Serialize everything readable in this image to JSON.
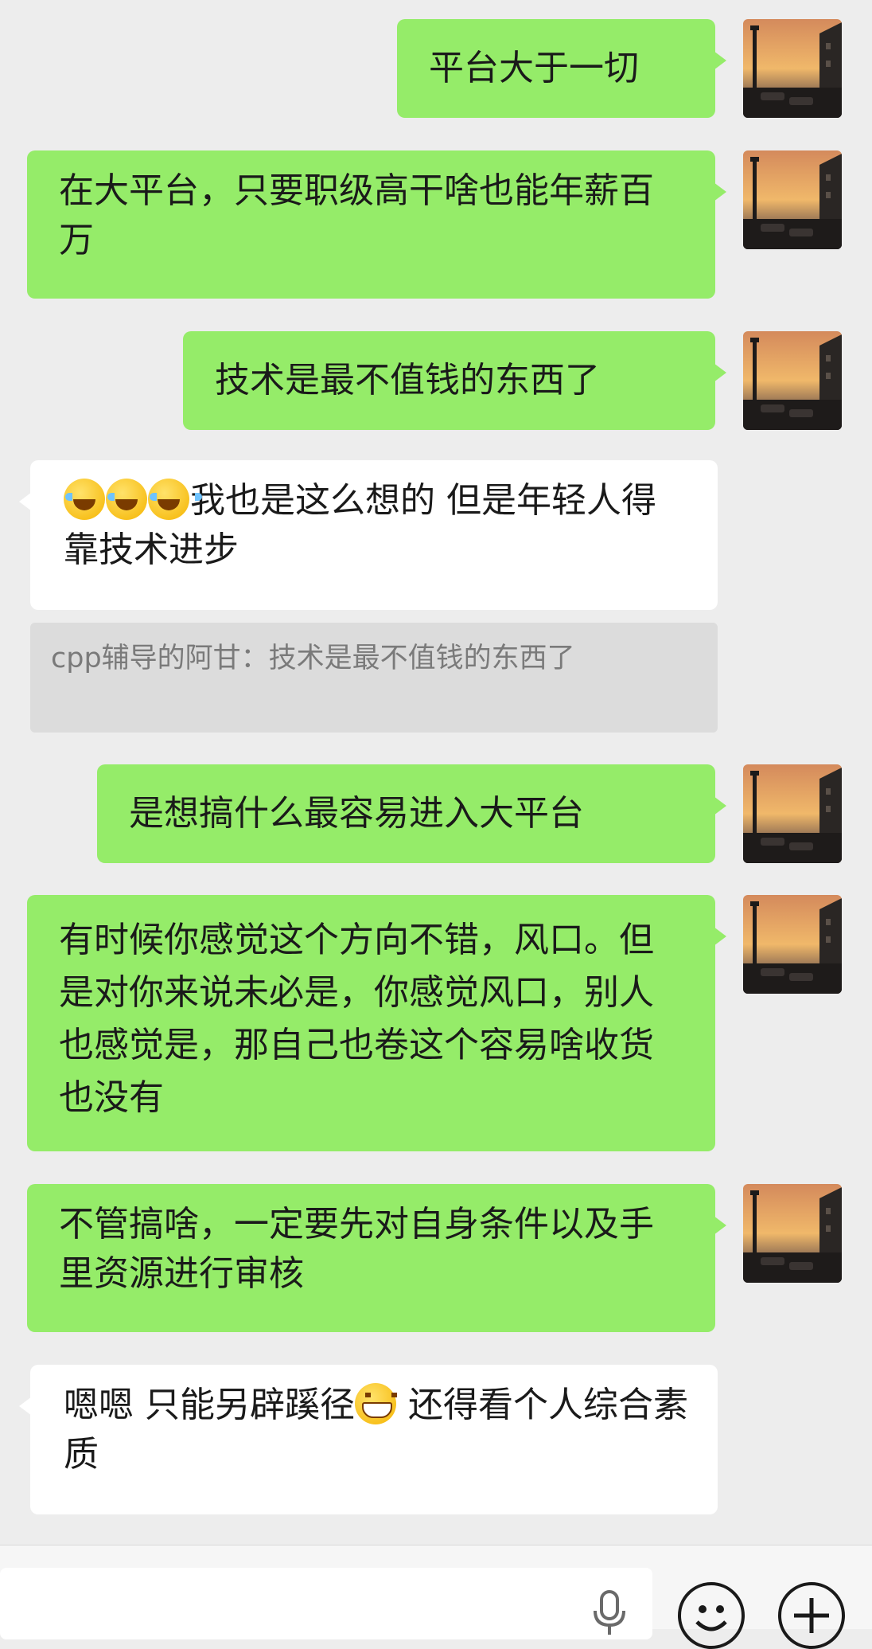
{
  "messages": [
    {
      "side": "out",
      "text": "平台大于一切"
    },
    {
      "side": "out",
      "text": "在大平台，只要职级高干啥也能年薪百万"
    },
    {
      "side": "out",
      "text": "技术是最不值钱的东西了"
    },
    {
      "side": "in",
      "emoji": [
        "face-with-tears-of-joy",
        "face-with-tears-of-joy",
        "face-with-tears-of-joy"
      ],
      "text": "我也是这么想的 但是年轻人得靠技术进步"
    },
    {
      "quote": "cpp辅导的阿甘：技术是最不值钱的东西了"
    },
    {
      "side": "out",
      "text": "是想搞什么最容易进入大平台"
    },
    {
      "side": "out",
      "text": "有时候你感觉这个方向不错，风口。但是对你来说未必是，你感觉风口，别人也感觉是，那自己也卷这个容易啥收货也没有"
    },
    {
      "side": "out",
      "text": "不管搞啥，一定要先对自身条件以及手里资源进行审核"
    },
    {
      "side": "in",
      "text_before": "嗯嗯 只能另辟蹊径",
      "emoji": "grinning-face",
      "text_after": " 还得看个人综合素质"
    }
  ],
  "input_bar": {
    "icons": [
      "voice-icon",
      "emoji-icon",
      "add-icon"
    ]
  },
  "colors": {
    "background": "#ededed",
    "outgoing_bubble": "#95ec69",
    "incoming_bubble": "#ffffff",
    "quote_background": "#dcdcdc",
    "quote_text": "#7a7a7a"
  }
}
